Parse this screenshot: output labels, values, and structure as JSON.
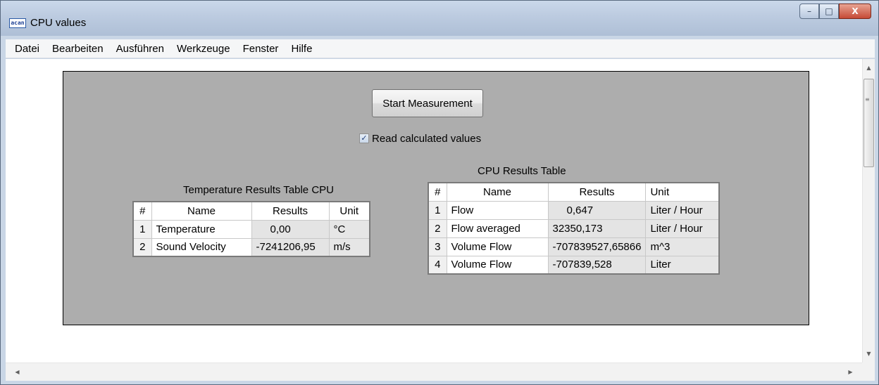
{
  "window": {
    "title": "CPU values",
    "icon_label": "acan",
    "controls": {
      "minimize": "–",
      "maximize": "□",
      "close": "X"
    }
  },
  "menu": [
    "Datei",
    "Bearbeiten",
    "Ausführen",
    "Werkzeuge",
    "Fenster",
    "Hilfe"
  ],
  "panel": {
    "start_button": "Start Measurement",
    "checkbox": {
      "label": "Read calculated values",
      "checked": true,
      "mark": "✓"
    }
  },
  "temperature_table": {
    "title": "Temperature Results Table CPU",
    "headers": [
      "#",
      "Name",
      "Results",
      "Unit"
    ],
    "rows": [
      {
        "idx": "1",
        "name": "Temperature",
        "result": "0,00",
        "unit": "°C"
      },
      {
        "idx": "2",
        "name": "Sound Velocity",
        "result": "-7241206,95",
        "unit": "m/s"
      }
    ]
  },
  "cpu_table": {
    "title": "CPU Results Table",
    "headers": [
      "#",
      "Name",
      "Results",
      "Unit"
    ],
    "rows": [
      {
        "idx": "1",
        "name": "Flow",
        "result": "0,647",
        "unit": "Liter / Hour"
      },
      {
        "idx": "2",
        "name": "Flow averaged",
        "result": "32350,173",
        "unit": "Liter / Hour"
      },
      {
        "idx": "3",
        "name": "Volume Flow",
        "result": "-707839527,65866",
        "unit": "m^3"
      },
      {
        "idx": "4",
        "name": "Volume Flow",
        "result": "-707839,528",
        "unit": "Liter"
      }
    ]
  },
  "scrollbars": {
    "up": "▲",
    "down": "▼",
    "left": "◀",
    "right": "▶",
    "grip": "≡"
  }
}
